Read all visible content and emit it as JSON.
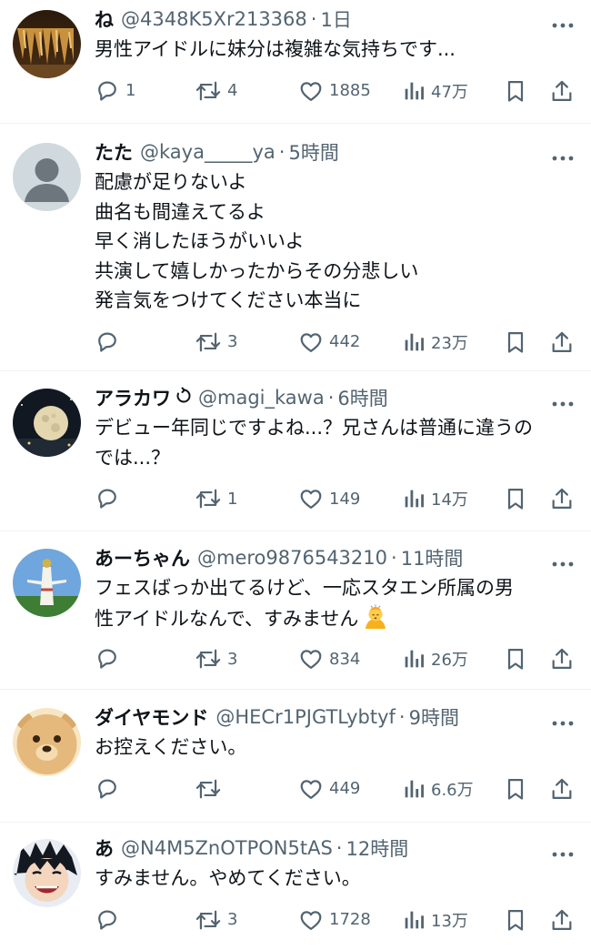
{
  "tweets": [
    {
      "name": "ね",
      "handle": "@4348K5Xr213368",
      "time": "1日",
      "lines": [
        "男性アイドルに妹分は複雑な気持ちです..."
      ],
      "reply": "1",
      "retweet": "4",
      "like": "1885",
      "views": "47万",
      "avatar_icon": "cave-photo-avatar"
    },
    {
      "name": "たた",
      "handle": "@kaya_____ya",
      "time": "5時間",
      "lines": [
        "配慮が足りないよ",
        "曲名も間違えてるよ",
        "早く消したほうがいいよ",
        "共演して嬉しかったからその分悲しい",
        "発言気をつけてください本当に"
      ],
      "reply": "",
      "retweet": "3",
      "like": "442",
      "views": "23万",
      "avatar_icon": "default-person-avatar"
    },
    {
      "name": "アラカワ",
      "handle": "@magi_kawa",
      "time": "6時間",
      "lines": [
        "デビュー年同じですよね...？兄さんは普通に違うの",
        "では...？"
      ],
      "reply": "",
      "retweet": "1",
      "like": "149",
      "views": "14万",
      "avatar_icon": "moon-photo-avatar"
    },
    {
      "name": "あーちゃん",
      "handle": "@mero9876543210",
      "time": "11時間",
      "lines": [
        "フェスばっか出てるけど、一応スタエン所属の男",
        "性アイドルなんで、すみません"
      ],
      "reply": "",
      "retweet": "3",
      "like": "834",
      "views": "26万",
      "avatar_icon": "tower-photo-avatar"
    },
    {
      "name": "ダイヤモンド",
      "handle": "@HECr1PJGTLybtyf",
      "time": "9時間",
      "lines": [
        "お控えください。"
      ],
      "reply": "",
      "retweet": "",
      "like": "449",
      "views": "6.6万",
      "avatar_icon": "bear-face-avatar"
    },
    {
      "name": "あ",
      "handle": "@N4M5ZnOTPON5tAS",
      "time": "12時間",
      "lines": [
        "すみません。やめてください。"
      ],
      "reply": "",
      "retweet": "3",
      "like": "1728",
      "views": "13万",
      "avatar_icon": "anime-character-avatar"
    }
  ],
  "colors": {
    "text": "#0f1419",
    "secondary": "#536471",
    "divider": "#eff3f4"
  }
}
